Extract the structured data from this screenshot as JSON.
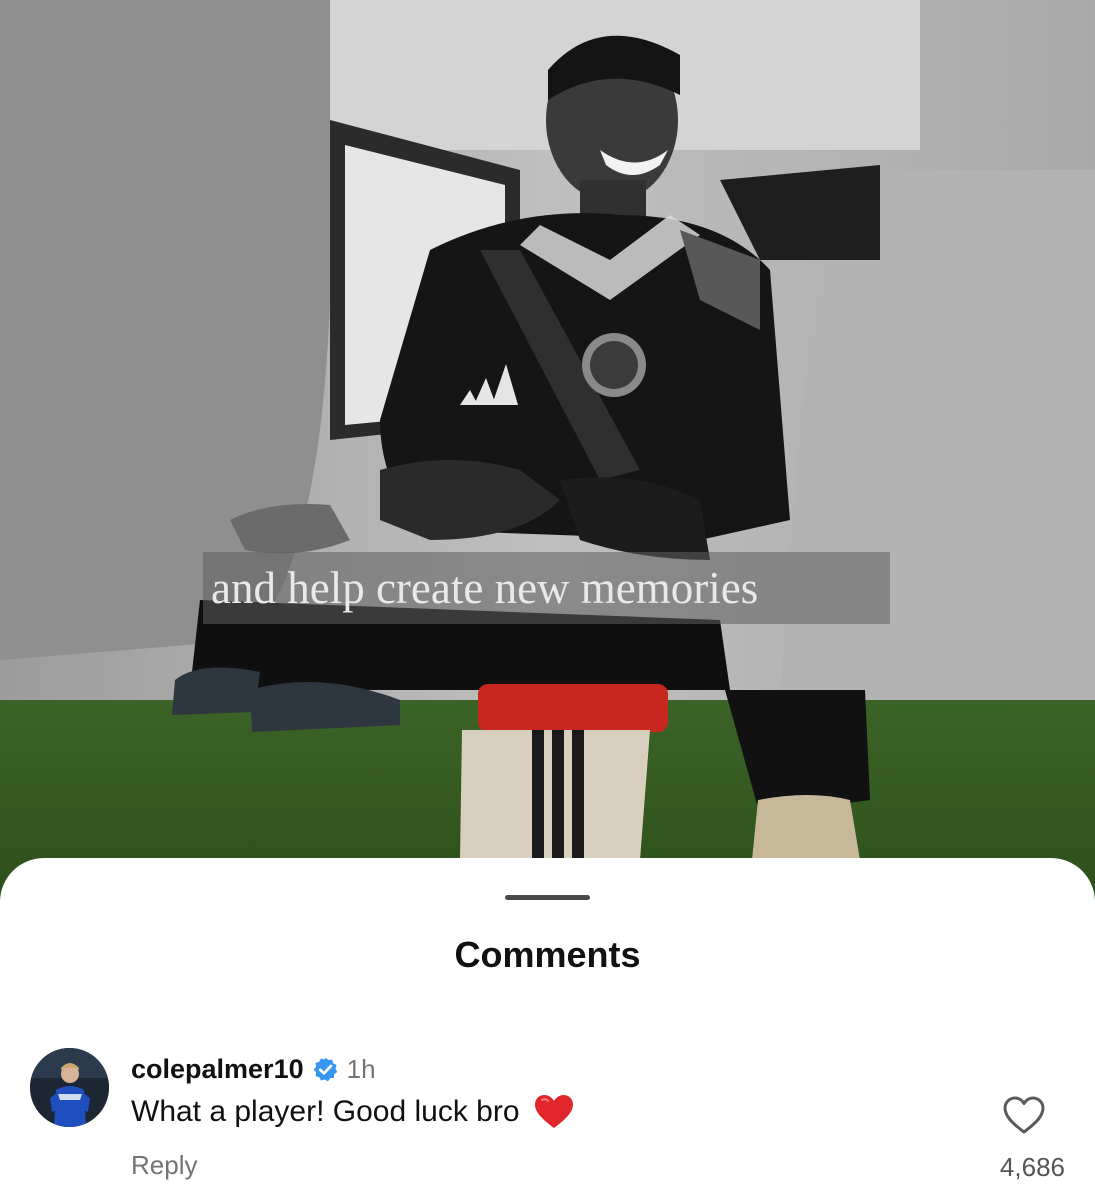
{
  "media": {
    "overlay_caption": "and help create new memories"
  },
  "comments_sheet": {
    "title": "Comments",
    "comments": [
      {
        "username": "colepalmer10",
        "verified": true,
        "timestamp": "1h",
        "text": "What a player! Good luck bro",
        "emoji": "red-heart",
        "reply_label": "Reply",
        "like_count": "4,686"
      }
    ]
  },
  "colors": {
    "verified_badge": "#3797f0",
    "heart_emoji": "#e0262a",
    "secondary_text": "#737373"
  }
}
